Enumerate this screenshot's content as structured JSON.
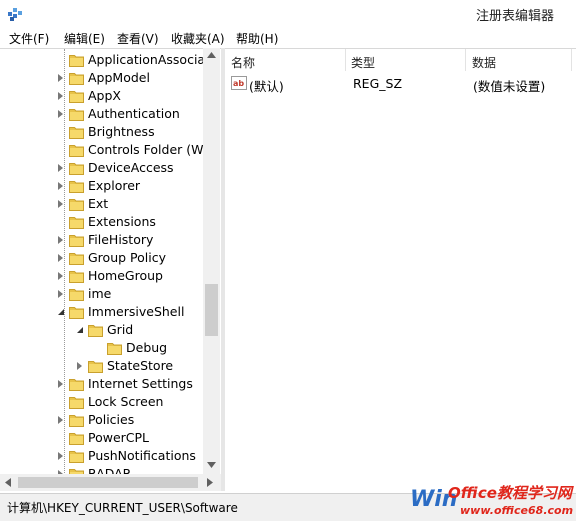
{
  "window": {
    "title": "注册表编辑器"
  },
  "menu": [
    "文件(F)",
    "编辑(E)",
    "查看(V)",
    "收藏夹(A)",
    "帮助(H)"
  ],
  "tree": [
    {
      "label": "ApplicationAssocia",
      "level": 1,
      "expander": "none"
    },
    {
      "label": "AppModel",
      "level": 1,
      "expander": "closed"
    },
    {
      "label": "AppX",
      "level": 1,
      "expander": "closed"
    },
    {
      "label": "Authentication",
      "level": 1,
      "expander": "closed"
    },
    {
      "label": "Brightness",
      "level": 1,
      "expander": "none"
    },
    {
      "label": "Controls Folder (W",
      "level": 1,
      "expander": "none"
    },
    {
      "label": "DeviceAccess",
      "level": 1,
      "expander": "closed"
    },
    {
      "label": "Explorer",
      "level": 1,
      "expander": "closed"
    },
    {
      "label": "Ext",
      "level": 1,
      "expander": "closed"
    },
    {
      "label": "Extensions",
      "level": 1,
      "expander": "none"
    },
    {
      "label": "FileHistory",
      "level": 1,
      "expander": "closed"
    },
    {
      "label": "Group Policy",
      "level": 1,
      "expander": "closed"
    },
    {
      "label": "HomeGroup",
      "level": 1,
      "expander": "closed"
    },
    {
      "label": "ime",
      "level": 1,
      "expander": "closed"
    },
    {
      "label": "ImmersiveShell",
      "level": 1,
      "expander": "open"
    },
    {
      "label": "Grid",
      "level": 2,
      "expander": "open"
    },
    {
      "label": "Debug",
      "level": 3,
      "expander": "none"
    },
    {
      "label": "StateStore",
      "level": 2,
      "expander": "closed"
    },
    {
      "label": "Internet Settings",
      "level": 1,
      "expander": "closed"
    },
    {
      "label": "Lock Screen",
      "level": 1,
      "expander": "none"
    },
    {
      "label": "Policies",
      "level": 1,
      "expander": "closed"
    },
    {
      "label": "PowerCPL",
      "level": 1,
      "expander": "none"
    },
    {
      "label": "PushNotifications",
      "level": 1,
      "expander": "closed"
    },
    {
      "label": "RADAR",
      "level": 1,
      "expander": "closed"
    }
  ],
  "list": {
    "headers": [
      "名称",
      "类型",
      "数据"
    ],
    "rows": [
      {
        "name": "(默认)",
        "type": "REG_SZ",
        "data": "(数值未设置)",
        "icon": "string-value-icon"
      }
    ]
  },
  "status": {
    "path": "计算机\\HKEY_CURRENT_USER\\Software"
  },
  "watermark": {
    "line1": "Office教程学习网",
    "line2": "www.office68.com"
  },
  "colors": {
    "folder": "#e8c34a",
    "folder_dark": "#c9a02d",
    "accent_red": "#e0261b"
  },
  "icons": [
    "regedit-app-icon",
    "folder-icon",
    "expand-arrow-icon",
    "collapse-arrow-icon",
    "scroll-up-icon",
    "scroll-down-icon",
    "scroll-left-icon",
    "scroll-right-icon"
  ]
}
